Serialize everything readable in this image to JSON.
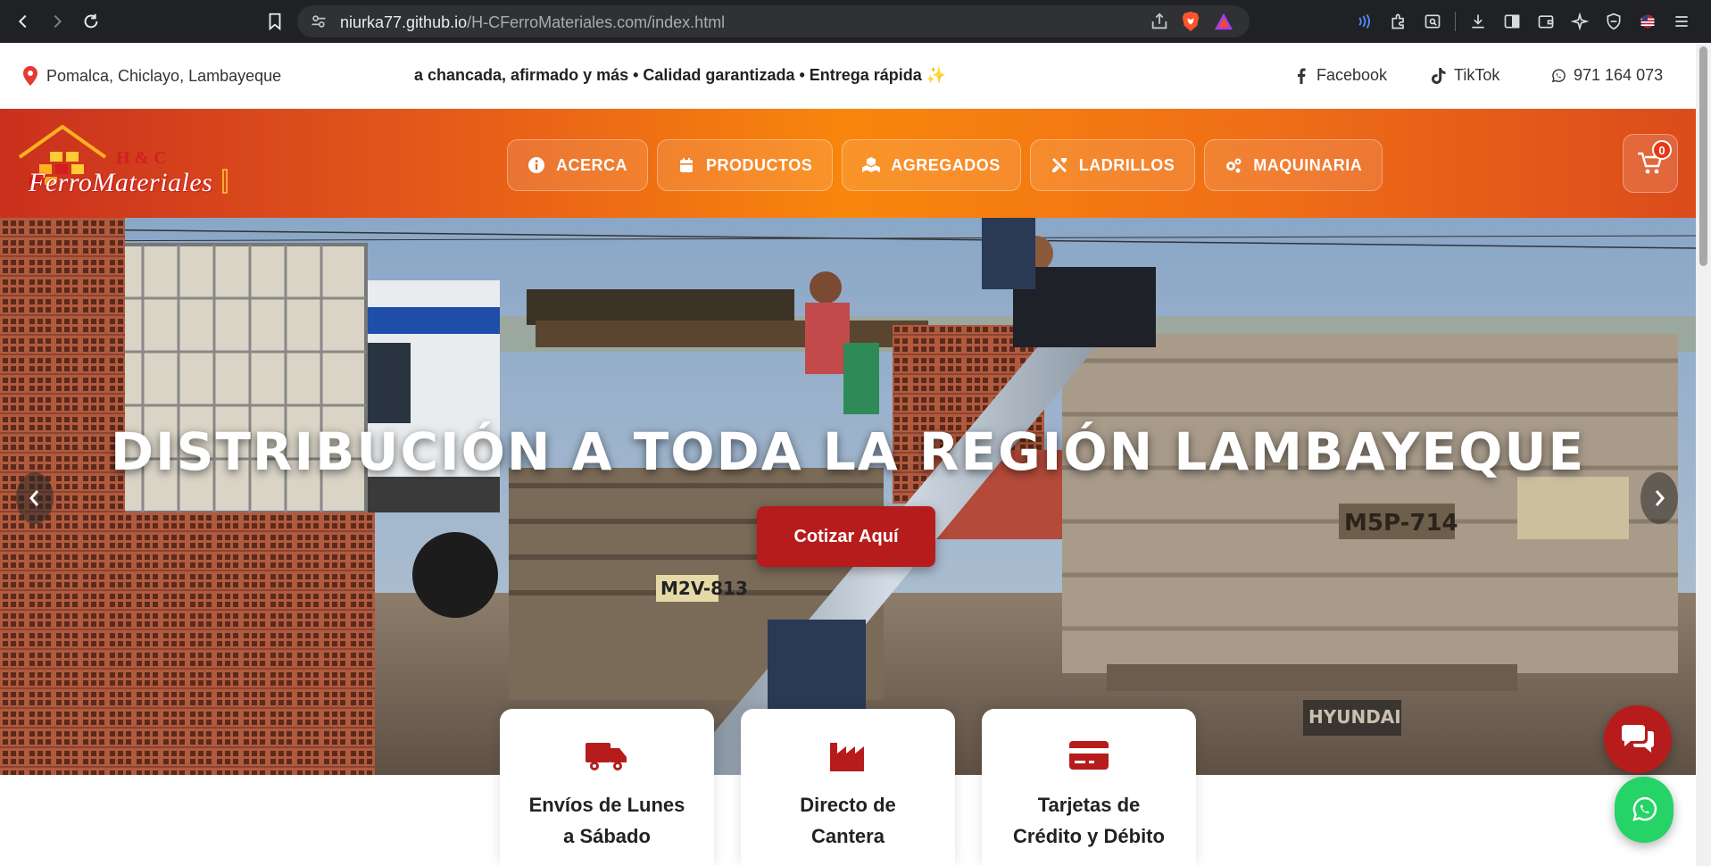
{
  "browser": {
    "url_host": "niurka77.github.io",
    "url_path": "/H-CFerroMateriales.com/index.html",
    "icons": [
      "back-icon",
      "forward-icon",
      "reload-icon",
      "bookmark-icon",
      "site-settings-icon",
      "share-icon",
      "brave-shields-icon",
      "brave-rewards-icon",
      "speedreader-icon",
      "extensions-icon",
      "reader-mode-icon",
      "download-icon",
      "sidebar-icon",
      "wallet-icon",
      "leo-ai-icon",
      "vpn-icon",
      "profile-icon",
      "menu-icon"
    ]
  },
  "topbar": {
    "location": "Pomalca, Chiclayo, Lambayeque",
    "marquee": "a chancada, afirmado y más • Calidad garantizada • Entrega rápida ✨",
    "facebook": "Facebook",
    "tiktok": "TikTok",
    "phone": "971 164 073"
  },
  "header": {
    "logo_top": "H & C",
    "logo_name": "FerroMateriales",
    "nav": [
      {
        "label": "ACERCA",
        "icon": "info-icon"
      },
      {
        "label": "PRODUCTOS",
        "icon": "calendar-icon"
      },
      {
        "label": "AGREGADOS",
        "icon": "cubes-icon"
      },
      {
        "label": "LADRILLOS",
        "icon": "tools-icon"
      },
      {
        "label": "MAQUINARIA",
        "icon": "cogs-icon"
      }
    ],
    "cart_count": "0"
  },
  "hero": {
    "title": "DISTRIBUCIÓN A TODA LA REGIÓN LAMBAYEQUE",
    "cta": "Cotizar Aquí",
    "plate_left": "M2V-813",
    "plate_right": "M5P-714",
    "truck_brand": "HYUNDAI"
  },
  "features": [
    {
      "line1": "Envíos de Lunes",
      "line2": "a Sábado",
      "icon": "truck-icon"
    },
    {
      "line1": "Directo de",
      "line2": "Cantera",
      "icon": "factory-icon"
    },
    {
      "line1": "Tarjetas de",
      "line2": "Crédito y Débito",
      "icon": "credit-card-icon"
    }
  ],
  "colors": {
    "brand_red": "#b71c1c",
    "header_orange": "#f9860c",
    "whatsapp_green": "#25d366"
  }
}
